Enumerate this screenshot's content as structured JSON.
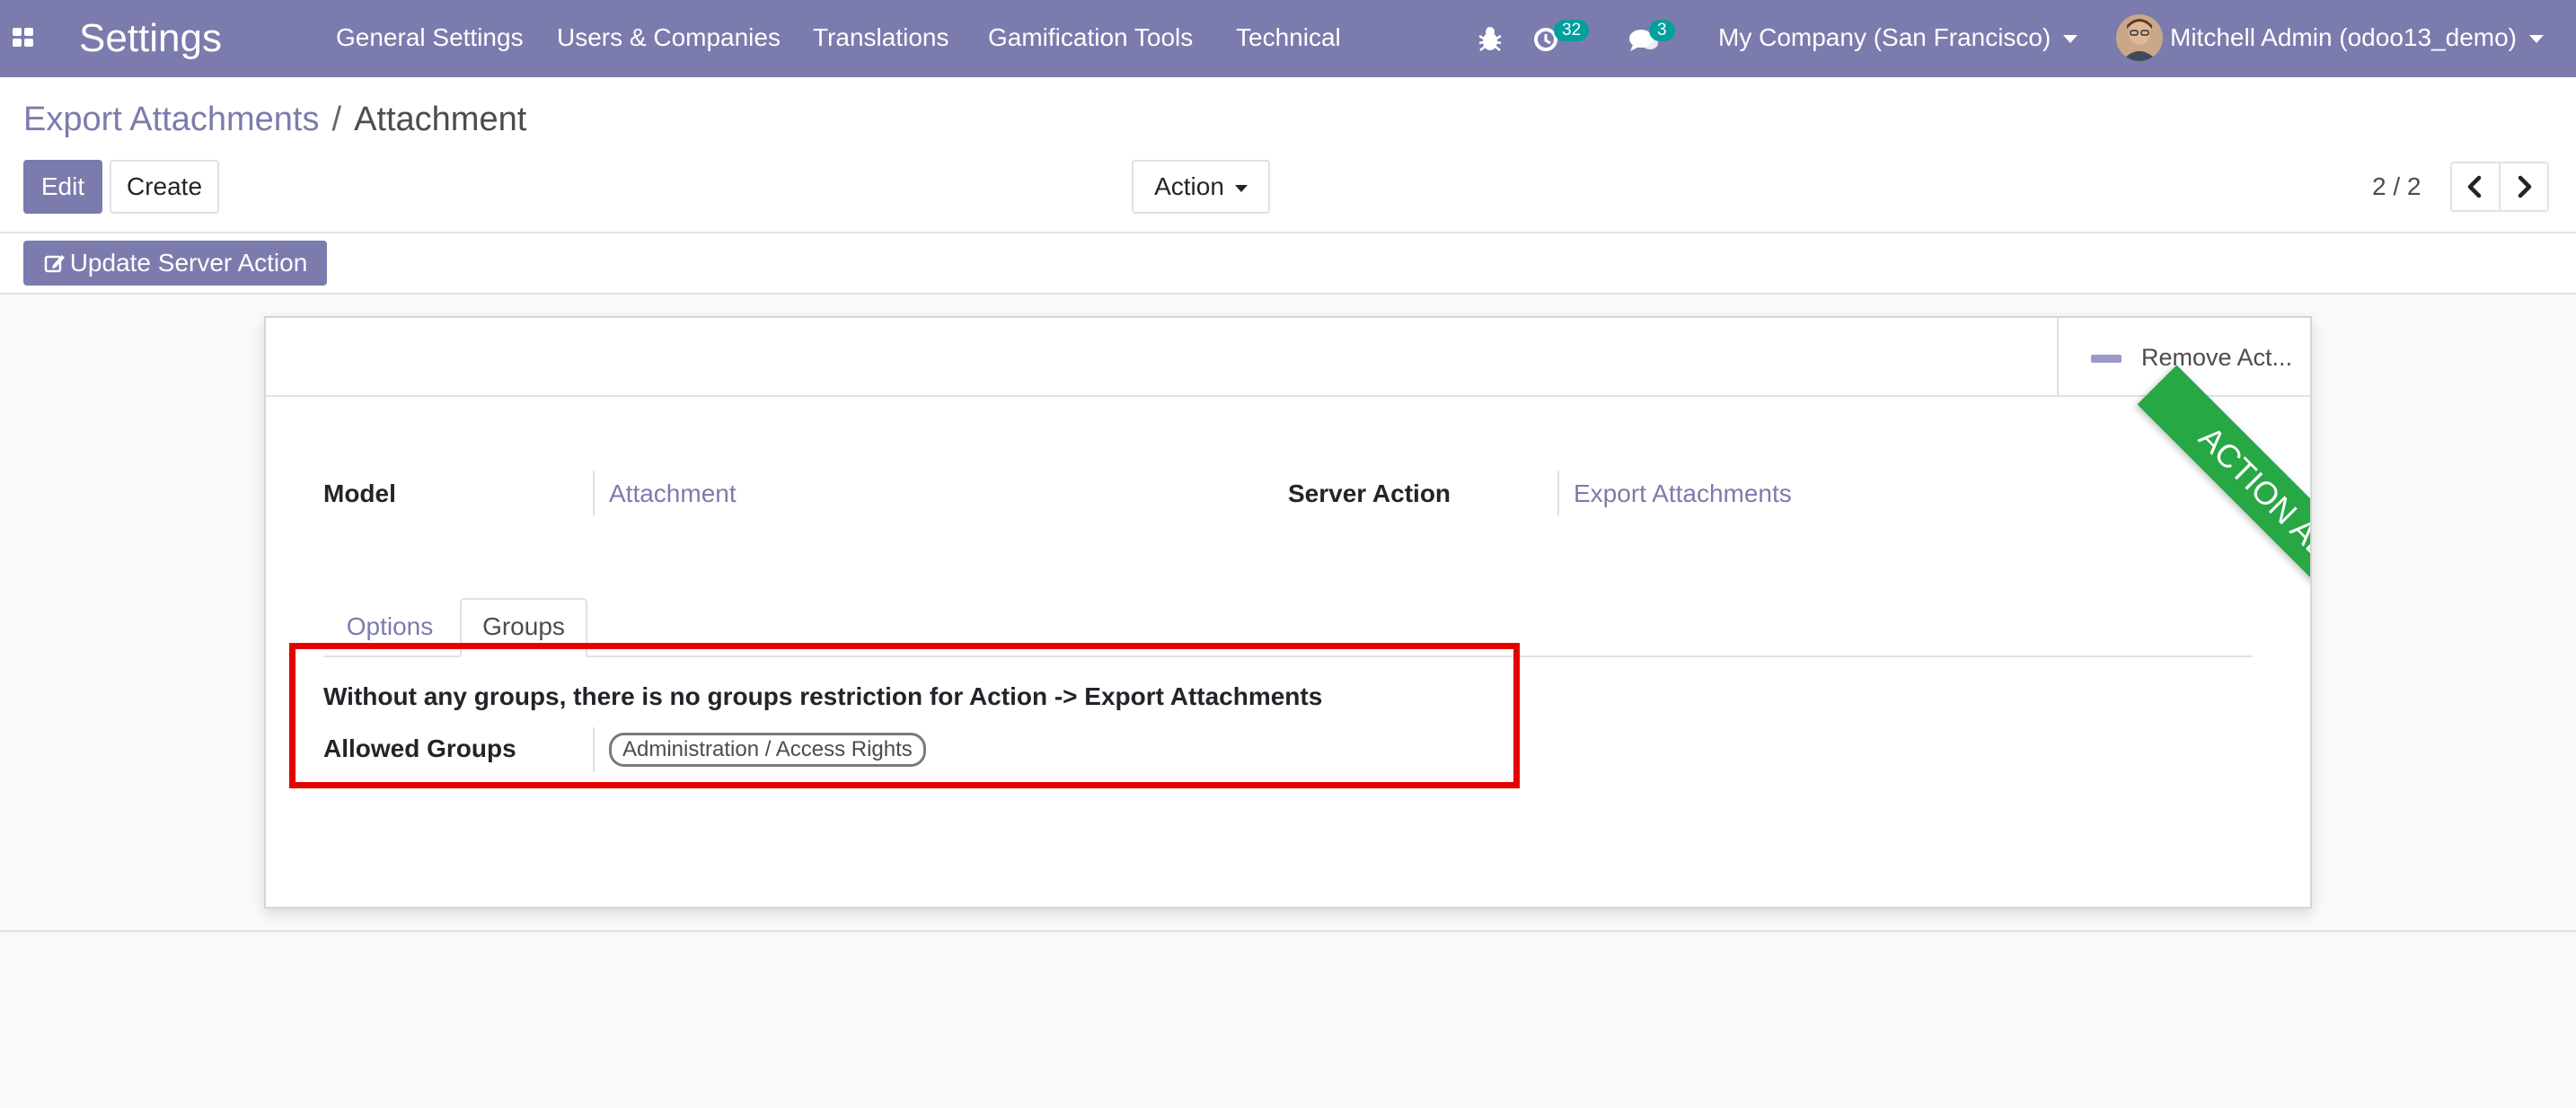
{
  "navbar": {
    "app_title": "Settings",
    "menu": [
      "General Settings",
      "Users & Companies",
      "Translations",
      "Gamification Tools",
      "Technical"
    ],
    "activity_count": "32",
    "message_count": "3",
    "company": "My Company (San Francisco)",
    "user": "Mitchell Admin (odoo13_demo)",
    "icons": [
      "apps-grid-icon",
      "bug-icon",
      "activity-clock-icon",
      "chat-bubbles-icon",
      "caret-down-icon"
    ]
  },
  "breadcrumb": {
    "parent": "Export Attachments",
    "separator": "/",
    "current": "Attachment"
  },
  "toolbar": {
    "edit_label": "Edit",
    "create_label": "Create",
    "action_label": "Action"
  },
  "pager": {
    "value": "2 / 2"
  },
  "statusbar": {
    "update_server_action_label": "Update Server Action"
  },
  "sheet": {
    "stat_button_label": "Remove Act...",
    "ribbon_text": "ACTION ADDED",
    "fields": {
      "model_label": "Model",
      "model_value": "Attachment",
      "server_action_label": "Server Action",
      "server_action_value": "Export Attachments"
    },
    "tabs": [
      {
        "label": "Options",
        "active": false
      },
      {
        "label": "Groups",
        "active": true
      }
    ],
    "groups_tab": {
      "info_text": "Without any groups, there is no groups restriction for Action -> Export Attachments",
      "allowed_groups_label": "Allowed Groups",
      "allowed_groups": [
        "Administration / Access Rights"
      ]
    }
  },
  "colors": {
    "brand": "#7c7bad",
    "badge": "#00a09d",
    "ribbon": "#28a745",
    "highlight_box": "#e60000"
  }
}
